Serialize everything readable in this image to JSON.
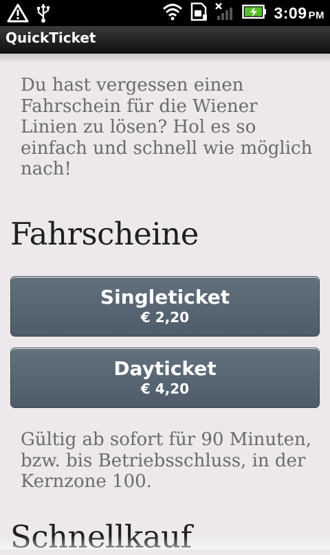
{
  "status_bar": {
    "time": "3:09",
    "ampm": "PM",
    "icons": [
      "warning-icon",
      "usb-icon",
      "wifi-icon",
      "sim-icon",
      "signal-off-icon",
      "battery-charging-icon"
    ]
  },
  "app": {
    "title": "QuickTicket"
  },
  "intro_text": "Du hast vergessen einen Fahrschein für die Wiener Linien zu lösen? Hol es so einfach und schnell wie möglich nach!",
  "sections": {
    "tickets_title": "Fahrscheine",
    "quick_title": "Schnellkauf"
  },
  "tickets": [
    {
      "name": "Singleticket",
      "price": "€ 2,20"
    },
    {
      "name": "Dayticket",
      "price": "€ 4,20"
    }
  ],
  "validity_text": "Gültig ab sofort für 90 Minuten, bzw. bis Betriebsschluss, in der Kernzone 100."
}
